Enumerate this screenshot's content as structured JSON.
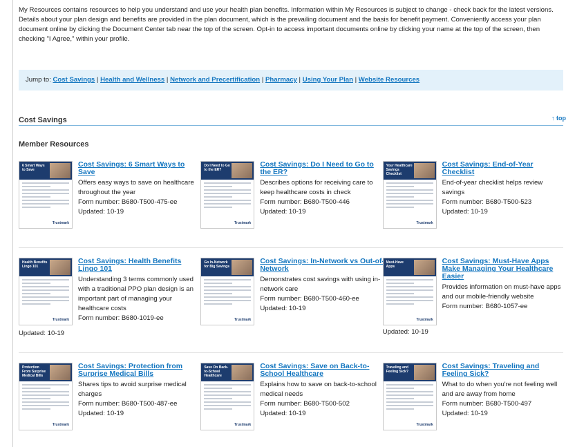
{
  "intro": {
    "p1": "My Resources contains resources to help you understand and use your health plan benefits. Information within My Resources is subject to change - check back for the latest versions.",
    "p2": "Details about your plan design and benefits are provided in the plan document, which is the prevailing document and the basis for benefit payment. Conveniently access your plan document online by clicking the Document Center tab near the top of the screen. Opt-in to access important documents online by clicking your name at the top of the screen, then checking \"I Agree,\" within your profile."
  },
  "jump": {
    "label": "Jump to:",
    "links": [
      "Cost Savings",
      "Health and Wellness",
      "Network and Precertification",
      "Pharmacy",
      "Using Your Plan",
      "Website Resources"
    ],
    "separator": "|"
  },
  "section": {
    "title": "Cost Savings",
    "top_link": "↑ top"
  },
  "subsection": {
    "title": "Member Resources"
  },
  "items": [
    {
      "title": "Cost Savings: 6 Smart Ways to Save",
      "desc": "Offers easy ways to save on healthcare throughout the year",
      "form": "Form number: B680-T500-475-ee",
      "updated": "Updated: 10-19",
      "thumb": "6 Smart Ways to Save"
    },
    {
      "title": "Cost Savings: Do I Need to Go to the ER?",
      "desc": "Describes options for receiving care to keep healthcare costs in check",
      "form": "Form number: B680-T500-446",
      "updated": "Updated: 10-19",
      "thumb": "Do I Need to Go to the ER?"
    },
    {
      "title": "Cost Savings: End-of-Year Checklist",
      "desc": "End-of-year checklist helps review savings",
      "form": "Form number: B680-T500-523",
      "updated": "Updated: 10-19",
      "thumb": "Your Healthcare Savings Checklist"
    },
    {
      "title": "Cost Savings: Health Benefits Lingo 101",
      "desc": "Understanding 3 terms commonly used with a traditional PPO plan design is an important part of managing your healthcare costs",
      "form": "Form number: B680-1019-ee",
      "updated": "Updated: 10-19",
      "thumb": "Health Benefits Lingo 101"
    },
    {
      "title": "Cost Savings: In-Network vs Out-of-Network",
      "desc": "Demonstrates cost savings with using in-network care",
      "form": "Form number: B680-T500-460-ee",
      "updated": "Updated: 10-19",
      "thumb": "Go In-Network for Big Savings"
    },
    {
      "title": "Cost Savings: Must-Have Apps Make Managing Your Healthcare Easier",
      "desc": "Provides information on must-have apps and our mobile-friendly website",
      "form": "Form number: B680-1057-ee",
      "updated": "Updated: 10-19",
      "thumb": "Must-Have Apps"
    },
    {
      "title": "Cost Savings: Protection from Surprise Medical Bills",
      "desc": "Shares tips to avoid surprise medical charges",
      "form": "Form number: B680-T500-487-ee",
      "updated": "Updated: 10-19",
      "thumb": "Protection From Surprise Medical Bills"
    },
    {
      "title": "Cost Savings: Save on Back-to-School Healthcare",
      "desc": "Explains how to save on back-to-school medical needs",
      "form": "Form number: B680-T500-502",
      "updated": "Updated: 10-19",
      "thumb": "Save On Back-to-School Healthcare"
    },
    {
      "title": "Cost Savings: Traveling and Feeling Sick?",
      "desc": "What to do when you're not feeling well and are away from home",
      "form": "Form number: B680-T500-497",
      "updated": "Updated: 10-19",
      "thumb": "Traveling and Feeling Sick?"
    }
  ],
  "thumb_logo": "Trustmark",
  "colors": {
    "link": "#1577c0",
    "jump_bg": "#e3f1fa",
    "thumb_band": "#1d3c6e"
  }
}
